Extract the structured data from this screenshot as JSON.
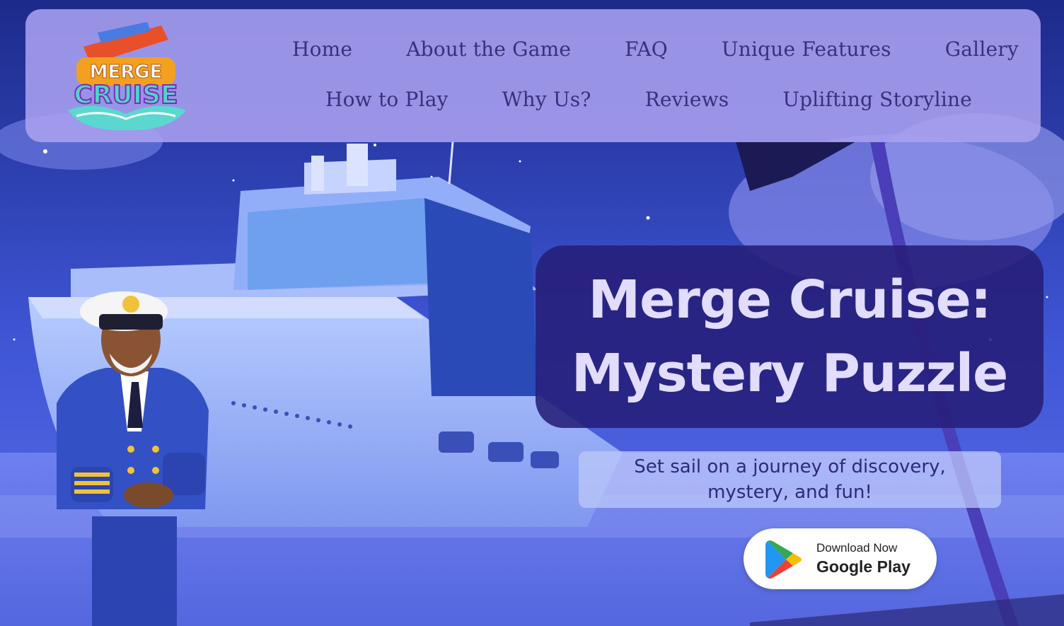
{
  "brand": {
    "logo_top": "MERGE",
    "logo_bottom": "CRUISE"
  },
  "nav": {
    "row1": [
      "Home",
      "About the Game",
      "FAQ",
      "Unique Features",
      "Gallery"
    ],
    "row2": [
      "How to Play",
      "Why Us?",
      "Reviews",
      "Uplifting Storyline"
    ]
  },
  "hero": {
    "title_line1": "Merge Cruise:",
    "title_line2": "Mystery Puzzle",
    "subtitle": "Set sail on a journey of discovery, mystery, and fun!"
  },
  "download": {
    "small_label": "Download Now",
    "store_label": "Google Play",
    "icon": "google-play-icon"
  },
  "colors": {
    "nav_text": "#3b2f7a",
    "title_text": "#e2dcff",
    "title_box": "#261e78",
    "nav_card": "#aaa0f0"
  }
}
